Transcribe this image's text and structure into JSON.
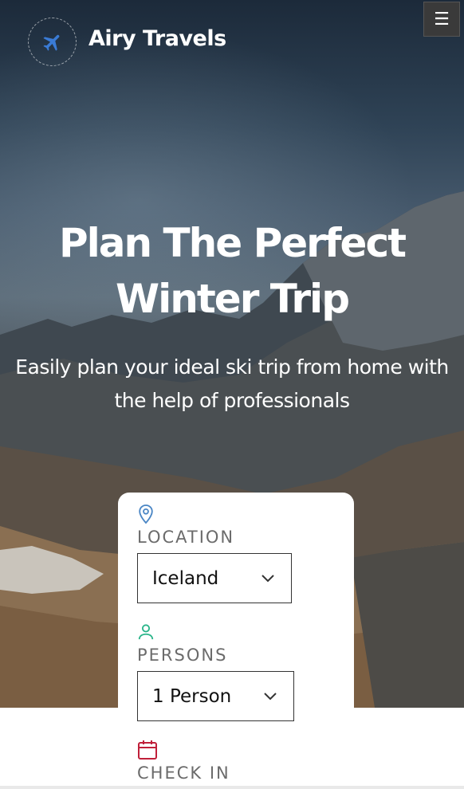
{
  "header": {
    "brand": "Airy Travels",
    "logo_icon": "airplane-icon",
    "menu_icon": "hamburger-menu-icon",
    "menu_glyph": "☰"
  },
  "hero": {
    "title_line1": "Plan The Perfect",
    "title_line2": "Winter Trip",
    "subtitle_line1": "Easily plan your ideal ski trip from home with",
    "subtitle_line2": "the help of professionals"
  },
  "booking": {
    "location": {
      "icon": "map-pin-icon",
      "label": "LOCATION",
      "value": "Iceland"
    },
    "persons": {
      "icon": "person-icon",
      "label": "PERSONS",
      "value": "1 Person"
    },
    "check_in": {
      "icon": "calendar-icon",
      "label": "CHECK IN"
    }
  },
  "colors": {
    "accent_blue": "#3a7bd5",
    "pin_blue": "#4a86c5",
    "person_green": "#2bb58a",
    "calendar_red": "#c0203a"
  }
}
